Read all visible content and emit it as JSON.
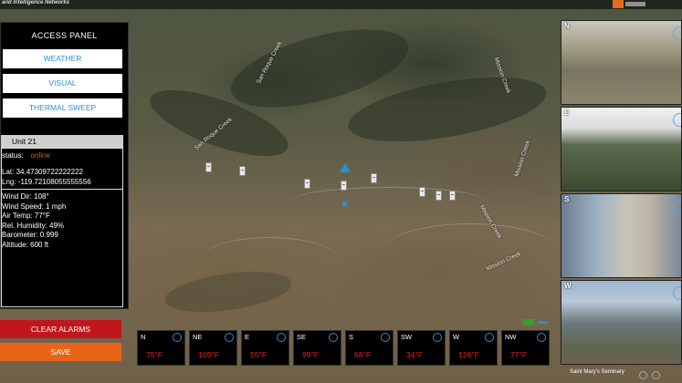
{
  "header": {
    "brand": "and Intelligence Networks"
  },
  "access_panel": {
    "title": "ACCESS PANEL",
    "buttons": [
      "WEATHER",
      "VISUAL",
      "THERMAL SWEEP"
    ],
    "unit": {
      "name": "Unit 21",
      "status_label": "status:",
      "status_value": "online",
      "lat": "Lat: 34.47309722222222",
      "lng": "Lng: -119.72108055555556",
      "weather": [
        "Wind Dir: 108°",
        "Wind Speed: 1 mph",
        "Air Temp: 77°F",
        "Rel. Humidity: 49%",
        "Barometer: 0.999",
        "Altitude: 600 ft"
      ]
    },
    "clear_alarms_label": "CLEAR ALARMS",
    "save_label": "SAVE"
  },
  "map": {
    "creek_labels": [
      "San Roque Creek",
      "San Roque Creek",
      "Mission Creek",
      "Mission Creek",
      "Mission Creek",
      "Mission Creek"
    ],
    "footer_label": "Saint Mary's Seminary"
  },
  "camera_feeds": [
    {
      "direction": "N"
    },
    {
      "direction": "E"
    },
    {
      "direction": "S"
    },
    {
      "direction": "W"
    }
  ],
  "temperature_tiles": [
    {
      "direction": "N",
      "temp": "75°F"
    },
    {
      "direction": "NE",
      "temp": "109°F"
    },
    {
      "direction": "E",
      "temp": "55°F"
    },
    {
      "direction": "SE",
      "temp": "99°F"
    },
    {
      "direction": "S",
      "temp": "68°F"
    },
    {
      "direction": "SW",
      "temp": "34°F"
    },
    {
      "direction": "W",
      "temp": "126°F"
    },
    {
      "direction": "NW",
      "temp": "77°F"
    }
  ],
  "colors": {
    "accent_blue": "#2a8fd8",
    "status_online": "#e05a1a",
    "clear_alarms_bg": "#c0161c",
    "save_bg": "#e86418",
    "temp_text": "#e0202a"
  }
}
